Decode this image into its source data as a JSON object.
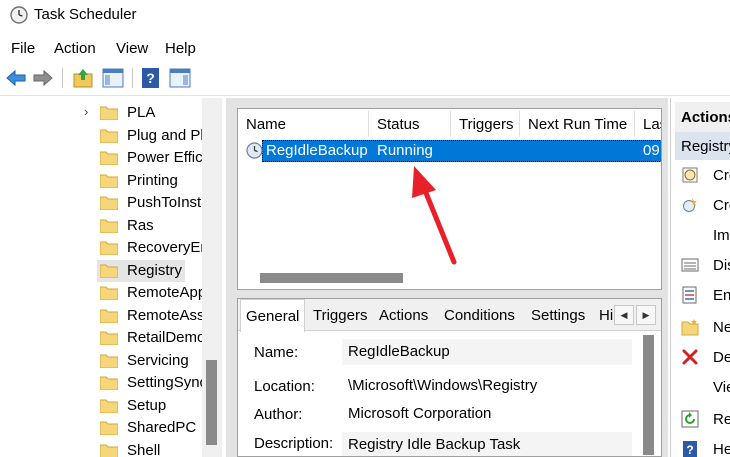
{
  "window": {
    "title": "Task Scheduler"
  },
  "menu": [
    "File",
    "Action",
    "View",
    "Help"
  ],
  "toolbar": {
    "icons": [
      "back-arrow-icon",
      "forward-arrow-icon",
      "up-folder-icon",
      "show-hide-console-tree-icon",
      "help-icon",
      "show-hide-action-pane-icon"
    ]
  },
  "tree": {
    "items": [
      {
        "label": "PLA",
        "expander": "›"
      },
      {
        "label": "Plug and Play"
      },
      {
        "label": "Power Efficiency Diagnostics"
      },
      {
        "label": "Printing"
      },
      {
        "label": "PushToInstall"
      },
      {
        "label": "Ras"
      },
      {
        "label": "RecoveryEnvironment"
      },
      {
        "label": "Registry",
        "selected": true
      },
      {
        "label": "RemoteApp and Desktop Connections Update"
      },
      {
        "label": "RemoteAssistance"
      },
      {
        "label": "RetailDemo"
      },
      {
        "label": "Servicing"
      },
      {
        "label": "SettingSync"
      },
      {
        "label": "Setup"
      },
      {
        "label": "SharedPC"
      },
      {
        "label": "Shell"
      }
    ]
  },
  "task_list": {
    "columns": [
      "Name",
      "Status",
      "Triggers",
      "Next Run Time",
      "Las"
    ],
    "rows": [
      {
        "name": "RegIdleBackup",
        "status": "Running",
        "triggers": "",
        "next_run": "",
        "last": "09"
      }
    ]
  },
  "detail": {
    "tabs": [
      "General",
      "Triggers",
      "Actions",
      "Conditions",
      "Settings",
      "Hi"
    ],
    "active_tab": "General",
    "fields": {
      "name_label": "Name:",
      "name_value": "RegIdleBackup",
      "location_label": "Location:",
      "location_value": "\\Microsoft\\Windows\\Registry",
      "author_label": "Author:",
      "author_value": "Microsoft Corporation",
      "description_label": "Description:",
      "description_value": "Registry Idle Backup Task"
    }
  },
  "actions_pane": {
    "header": "Actions",
    "section": "Registry",
    "items": [
      {
        "label": "Cre",
        "icon": "create-basic-task-icon"
      },
      {
        "label": "Cre",
        "icon": "create-task-icon"
      },
      {
        "label": "Im",
        "icon": ""
      },
      {
        "label": "Dis",
        "icon": "display-running-tasks-icon"
      },
      {
        "label": "En",
        "icon": "enable-history-icon"
      },
      {
        "label": "Ne",
        "icon": "new-folder-icon"
      },
      {
        "label": "De",
        "icon": "delete-folder-icon"
      },
      {
        "label": "Vie",
        "icon": ""
      },
      {
        "label": "Re",
        "icon": "refresh-icon"
      },
      {
        "label": "He",
        "icon": "help-icon"
      }
    ]
  },
  "colors": {
    "selection": "#0078d7",
    "annotation_arrow": "#e8202a"
  }
}
